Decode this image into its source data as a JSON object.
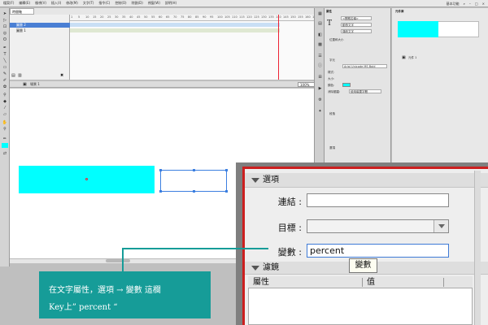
{
  "menubar": {
    "items": [
      "檔案(F)",
      "編輯(E)",
      "檢視(V)",
      "插入(I)",
      "修改(M)",
      "文字(T)",
      "指令(C)",
      "控制(O)",
      "除錯(D)",
      "視窗(W)",
      "說明(H)"
    ],
    "workspace": "基本功能"
  },
  "timeline": {
    "tab": "時間軸",
    "layers": [
      {
        "name": "圖層 2",
        "selected": true
      },
      {
        "name": "圖層 1",
        "selected": false
      }
    ],
    "ruler_numbers": [
      "1",
      "5",
      "10",
      "15",
      "20",
      "25",
      "30",
      "35",
      "40",
      "45",
      "50",
      "55",
      "60",
      "65",
      "70",
      "75",
      "80",
      "85",
      "90",
      "95",
      "100",
      "105",
      "110",
      "115",
      "120",
      "125",
      "130",
      "135",
      "140",
      "145",
      "150",
      "155",
      "160",
      "165"
    ]
  },
  "stage": {
    "scene": "場景 1",
    "zoom": "100%"
  },
  "properties": {
    "title": "屬性",
    "instance_placeholder": "<實體名稱>",
    "text_type": "動態文字",
    "text_engine": "傳統文字",
    "sections": [
      "位置和大小",
      "字元",
      "段落",
      "選項",
      "濾鏡"
    ],
    "font_family": "Arial Unicode MS Bold",
    "style_label": "樣式:",
    "size_label": "大小:",
    "color_label": "顏色:",
    "aa_label": "消除鋸齒:",
    "aa_value": "使用裝置字體"
  },
  "library": {
    "title": "元件庫",
    "item": "元件 1"
  },
  "callout": {
    "text": "在文字屬性，選項 → 變數 這欄\nKey上” percent “"
  },
  "zoom_panel": {
    "options_header": "選項",
    "link_label": "連結 :",
    "link_value": "",
    "target_label": "目標 :",
    "target_value": "",
    "variable_label": "變數 :",
    "variable_value": "percent",
    "tooltip": "變數",
    "filters_header": "濾鏡",
    "col_property": "屬性",
    "col_value": "值"
  },
  "colors": {
    "accent_teal": "#169c98",
    "highlight_red": "#cc1f1f",
    "cyan_shape": "#00ffff",
    "selection_blue": "#3c7fe0"
  }
}
